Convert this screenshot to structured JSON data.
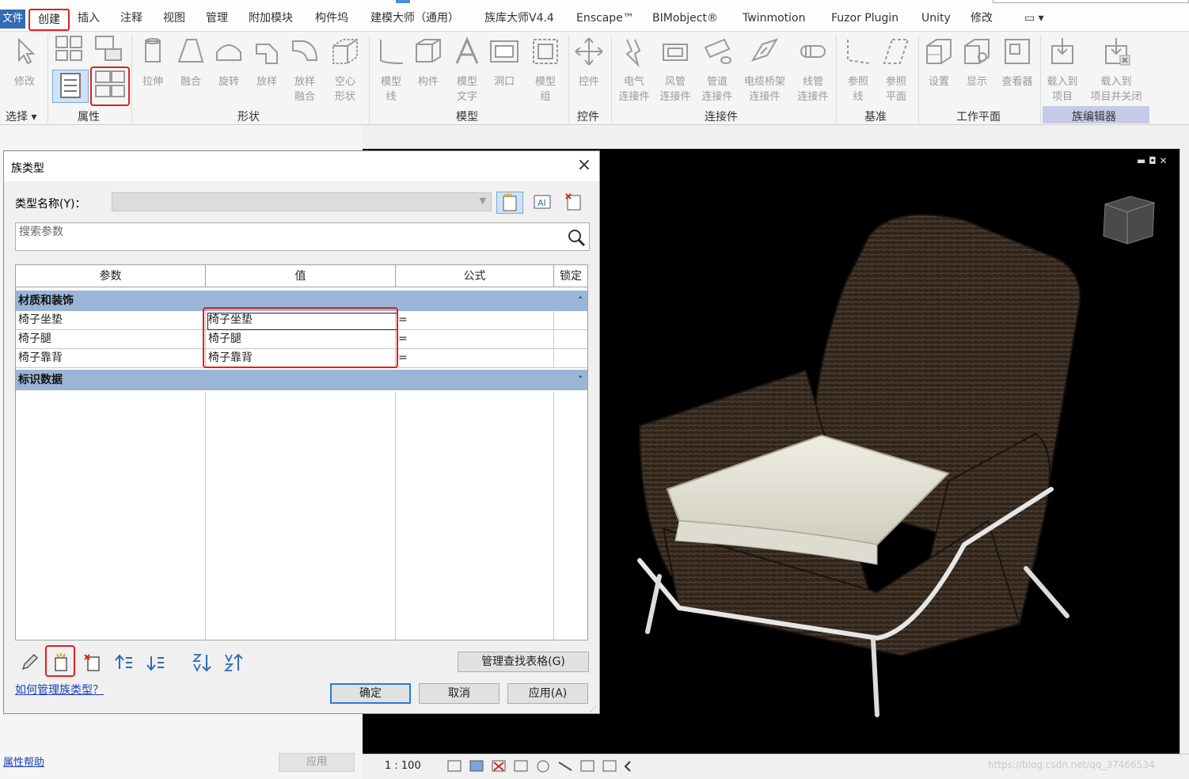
{
  "menubar": {
    "file": "文件",
    "tabs": [
      "创建",
      "插入",
      "注释",
      "视图",
      "管理",
      "附加模块",
      "构件坞",
      "建模大师（通用）",
      "族库大师V4.4",
      "Enscape™",
      "BIMobject®",
      "Twinmotion",
      "Fuzor Plugin",
      "Unity",
      "修改"
    ],
    "active_tab": "创建",
    "extra": "▭ ▾"
  },
  "ribbon": {
    "select": {
      "modify": "修改",
      "panel": "选择 ▾"
    },
    "properties": {
      "panel": "属性"
    },
    "forms": {
      "items": [
        "拉伸",
        "融合",
        "旋转",
        "放样",
        "放样\n融合",
        "空心\n形状"
      ],
      "panel": "形状"
    },
    "model": {
      "items": [
        "模型\n线",
        "构件",
        "模型\n文字",
        "洞口",
        "模型\n组"
      ],
      "panel": "模型"
    },
    "control": {
      "items": [
        "控件"
      ],
      "panel": "控件"
    },
    "connectors": {
      "items": [
        "电气\n连接件",
        "风管\n连接件",
        "管道\n连接件",
        "电缆桥架\n连接件",
        "线管\n连接件"
      ],
      "panel": "连接件"
    },
    "datum": {
      "items": [
        "参照\n线",
        "参照\n平面"
      ],
      "panel": "基准"
    },
    "work_plane": {
      "items": [
        "设置",
        "显示",
        "查看器"
      ],
      "panel": "工作平面"
    },
    "family_editor": {
      "items": [
        "载入到\n项目",
        "载入到\n项目并关闭"
      ],
      "panel": "族编辑器"
    }
  },
  "dialog": {
    "title": "族类型",
    "type_name_label": "类型名称(Y)：",
    "type_name_value": "",
    "search_placeholder": "搜索参数",
    "columns": [
      "参数",
      "值",
      "公式",
      "锁定"
    ],
    "groups": [
      {
        "name": "材质和装饰",
        "chevron": "˄",
        "rows": [
          {
            "param": "椅子坐垫",
            "value": "椅子坐垫",
            "formula": "="
          },
          {
            "param": "椅子腿",
            "value": "椅子腿",
            "formula": "="
          },
          {
            "param": "椅子靠背",
            "value": "椅子靠背",
            "formula": "="
          }
        ]
      },
      {
        "name": "标识数据",
        "chevron": "˅",
        "rows": []
      }
    ],
    "manage_lookup": "管理查找表格(G)",
    "help_link": "如何管理族类型？",
    "ok": "确定",
    "cancel": "取消",
    "apply": "应用(A)",
    "tool_icons": [
      "pencil-icon",
      "new-parameter-icon",
      "delete-parameter-icon",
      "move-up-icon",
      "move-down-icon",
      "sort-ascending-icon",
      "sort-descending-icon"
    ]
  },
  "properties_panel": {
    "help": "属性帮助",
    "apply": "应用"
  },
  "statusbar": {
    "scale": "1 : 100",
    "watermark": "https://blog.csdn.net/qq_37466534"
  },
  "colors": {
    "highlight": "#e02020",
    "group_header": "#9bb5d6",
    "accent": "#2f6cb3"
  }
}
